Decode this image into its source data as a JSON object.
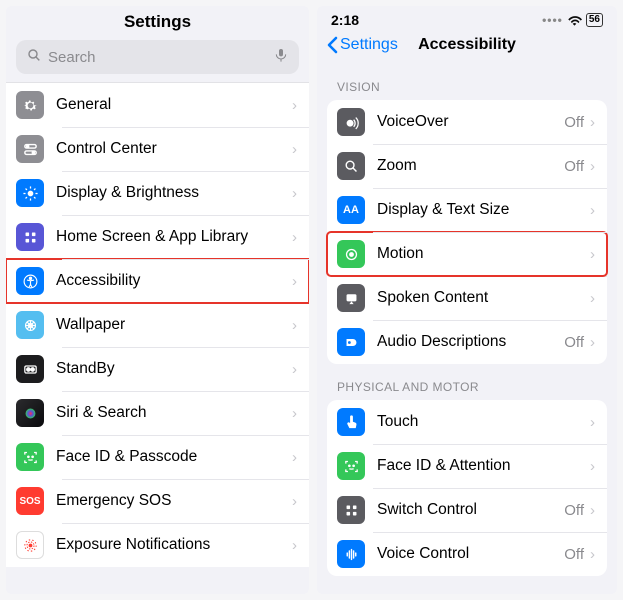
{
  "left": {
    "title": "Settings",
    "search_placeholder": "Search",
    "items": [
      {
        "label": "General"
      },
      {
        "label": "Control Center"
      },
      {
        "label": "Display & Brightness"
      },
      {
        "label": "Home Screen & App Library"
      },
      {
        "label": "Accessibility"
      },
      {
        "label": "Wallpaper"
      },
      {
        "label": "StandBy"
      },
      {
        "label": "Siri & Search"
      },
      {
        "label": "Face ID & Passcode"
      },
      {
        "label": "Emergency SOS"
      },
      {
        "label": "Exposure Notifications"
      }
    ]
  },
  "right": {
    "time": "2:18",
    "battery": "56",
    "back": "Settings",
    "title": "Accessibility",
    "section1": "VISION",
    "section2": "PHYSICAL AND MOTOR",
    "vision": [
      {
        "label": "VoiceOver",
        "value": "Off"
      },
      {
        "label": "Zoom",
        "value": "Off"
      },
      {
        "label": "Display & Text Size",
        "value": ""
      },
      {
        "label": "Motion",
        "value": ""
      },
      {
        "label": "Spoken Content",
        "value": ""
      },
      {
        "label": "Audio Descriptions",
        "value": "Off"
      }
    ],
    "motor": [
      {
        "label": "Touch",
        "value": ""
      },
      {
        "label": "Face ID & Attention",
        "value": ""
      },
      {
        "label": "Switch Control",
        "value": "Off"
      },
      {
        "label": "Voice Control",
        "value": "Off"
      }
    ]
  }
}
